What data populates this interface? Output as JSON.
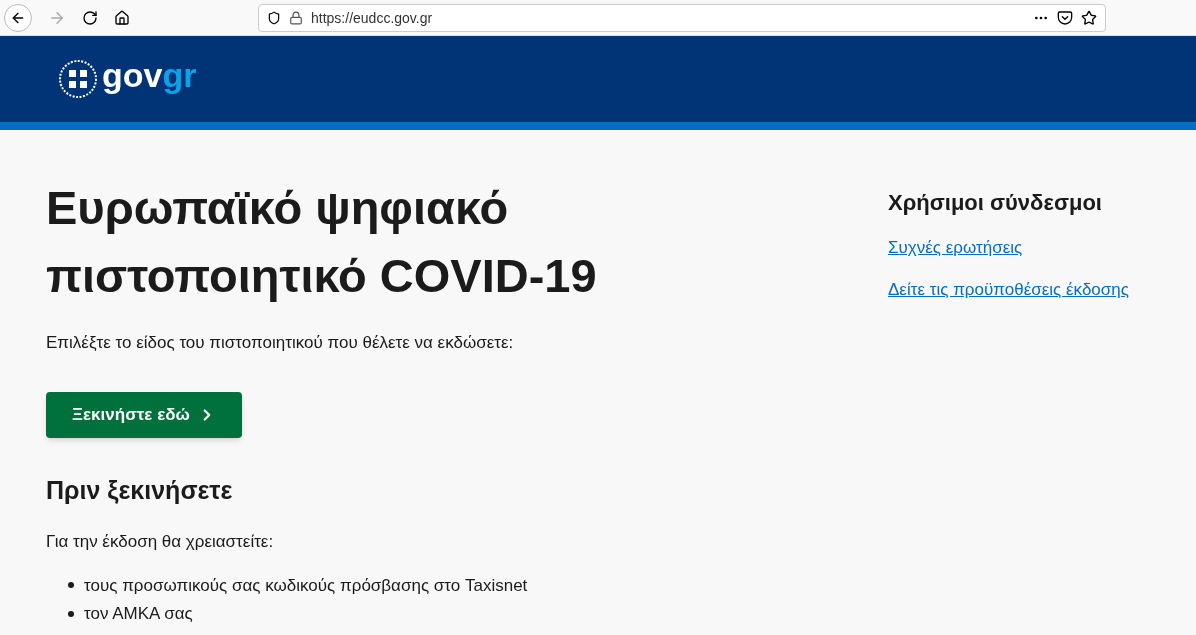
{
  "browser": {
    "url": "https://eudcc.gov.gr"
  },
  "header": {
    "logo": {
      "part_1": "gov",
      "part_2": "gr"
    }
  },
  "main": {
    "title": "Ευρωπαϊκό ψηφιακό πιστοποιητικό COVID-19",
    "intro": "Επιλέξτε το είδος του πιστοποιητικού που θέλετε να εκδώσετε:",
    "start_button": "Ξεκινήστε εδώ",
    "section_title": "Πριν ξεκινήσετε",
    "section_intro": "Για την έκδοση θα χρειαστείτε:",
    "requirements": [
      "τους προσωπικούς σας κωδικούς πρόσβασης στο Taxisnet",
      "τον ΑΜΚΑ σας"
    ]
  },
  "sidebar": {
    "title": "Χρήσιμοι σύνδεσμοι",
    "links": [
      "Συχνές ερωτήσεις",
      "Δείτε τις προϋποθέσεις έκδοσης"
    ]
  }
}
